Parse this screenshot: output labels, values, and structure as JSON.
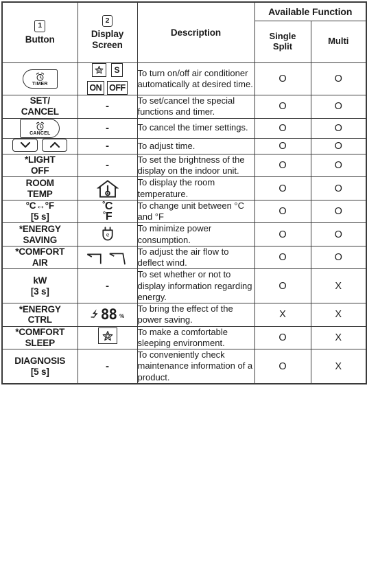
{
  "table": {
    "headers": {
      "button": {
        "badge": "1",
        "label": "Button"
      },
      "display": {
        "badge": "2",
        "label_line1": "Display",
        "label_line2": "Screen"
      },
      "description": "Description",
      "available_function": "Available Function",
      "single_split_line1": "Single",
      "single_split_line2": "Split",
      "multi": "Multi"
    },
    "dash": "-",
    "rows": [
      {
        "id": "timer",
        "button_type": "icon",
        "button_icon": "timer-button-icon",
        "button_icon_label": "TIMER",
        "display_type": "lcd-timer",
        "lcd_star": "star-icon",
        "lcd_s": "S",
        "lcd_on": "ON",
        "lcd_off": "OFF",
        "description": "To turn on/off air conditioner automatically at desired time.",
        "single_split": "O",
        "multi": "O"
      },
      {
        "id": "set-cancel",
        "button_type": "text",
        "button_line1": "SET/",
        "button_line2": "CANCEL",
        "display_type": "dash",
        "description": "To set/cancel the special functions and timer.",
        "single_split": "O",
        "multi": "O"
      },
      {
        "id": "cancel",
        "button_type": "icon",
        "button_icon": "cancel-button-icon",
        "button_icon_label": "CANCEL",
        "display_type": "dash",
        "description": "To cancel the timer settings.",
        "single_split": "O",
        "multi": "O"
      },
      {
        "id": "time-adjust",
        "button_type": "arrows",
        "button_icon": "down-up-arrow-buttons-icon",
        "display_type": "dash",
        "description": "To adjust time.",
        "single_split": "O",
        "multi": "O"
      },
      {
        "id": "light-off",
        "button_type": "text",
        "button_line1": "*LIGHT",
        "button_line2": "OFF",
        "display_type": "dash",
        "description": "To set the brightness of the display on the indoor unit.",
        "single_split": "O",
        "multi": "O"
      },
      {
        "id": "room-temp",
        "button_type": "text",
        "button_line1": "ROOM",
        "button_line2": "TEMP",
        "display_type": "house-thermometer",
        "display_icon": "house-thermometer-icon",
        "description": "To display the room temperature.",
        "single_split": "O",
        "multi": "O"
      },
      {
        "id": "celsius-fahrenheit",
        "button_type": "text",
        "button_line1": "°C↔°F",
        "button_line2": "[5 s]",
        "display_type": "cf",
        "display_line1_deg": "°",
        "display_line1": "C",
        "display_line2_deg": "°",
        "display_line2": "F",
        "description": "To change unit between °C and °F",
        "single_split": "O",
        "multi": "O"
      },
      {
        "id": "energy-saving",
        "button_type": "text",
        "button_line1": "*ENERGY",
        "button_line2": "SAVING",
        "display_type": "plug",
        "display_icon": "power-plug-e-icon",
        "description": "To minimize power consumption.",
        "single_split": "O",
        "multi": "O"
      },
      {
        "id": "comfort-air",
        "button_type": "text",
        "button_line1": "*COMFORT",
        "button_line2": "AIR",
        "display_type": "airflow",
        "display_icon": "air-deflection-icon",
        "description": "To adjust the air flow to deflect wind.",
        "single_split": "O",
        "multi": "O"
      },
      {
        "id": "kw",
        "button_type": "text",
        "button_line1": "kW",
        "button_line2": "[3 s]",
        "display_type": "dash",
        "description": "To set whether or not to display information regarding energy.",
        "single_split": "O",
        "multi": "X"
      },
      {
        "id": "energy-ctrl",
        "button_type": "text",
        "button_line1": "*ENERGY",
        "button_line2": "CTRL",
        "display_type": "energy-ctrl",
        "display_icon": "energy-bolt-icon",
        "display_digits": "88",
        "display_unit": "%",
        "description": "To bring the effect of the power saving.",
        "single_split": "X",
        "multi": "X"
      },
      {
        "id": "comfort-sleep",
        "button_type": "text",
        "button_line1": "*COMFORT",
        "button_line2": "SLEEP",
        "display_type": "star-box",
        "display_icon": "star-icon",
        "description": "To make a comfortable sleeping environment.",
        "single_split": "O",
        "multi": "X"
      },
      {
        "id": "diagnosis",
        "button_type": "text",
        "button_line1": "DIAGNOSIS",
        "button_line2": "[5 s]",
        "display_type": "dash",
        "description": "To conveniently check maintenance information of a product.",
        "single_split": "O",
        "multi": "X"
      }
    ]
  },
  "colors": {
    "border": "#3a3a3a",
    "text": "#1a1a1a",
    "background": "#ffffff"
  }
}
